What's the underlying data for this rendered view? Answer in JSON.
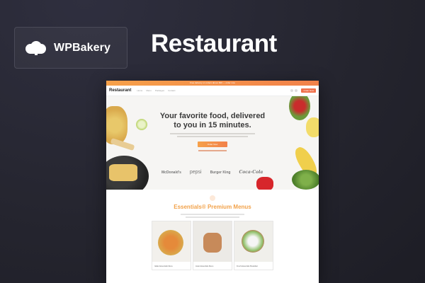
{
  "brand": {
    "name": "WPBakery",
    "logo_icon": "cloud-icon"
  },
  "title": "Restaurant",
  "preview": {
    "topbar_text": "Free delivery on orders above $30 — order now",
    "site_logo": "Restaurant",
    "nav_links": [
      "Home",
      "Menu",
      "Packages",
      "Contact"
    ],
    "nav_cta": "Order Now",
    "hero_headline": "Your favorite food, delivered to you in 15 minutes.",
    "hero_button": "Order Now",
    "partners": [
      "McDonald's",
      "pepsi",
      "Burger King",
      "Coca-Cola"
    ],
    "menu_title": "Essentials® Premium Menus",
    "cards": [
      {
        "caption": "Italian Essentials Menu"
      },
      {
        "caption": "Asian Essentials Menu"
      },
      {
        "caption": "Fresh Essentials Breakfast"
      }
    ]
  },
  "colors": {
    "accent": "#f2814a",
    "accent_light": "#f6a14a",
    "background": "#25252f"
  }
}
